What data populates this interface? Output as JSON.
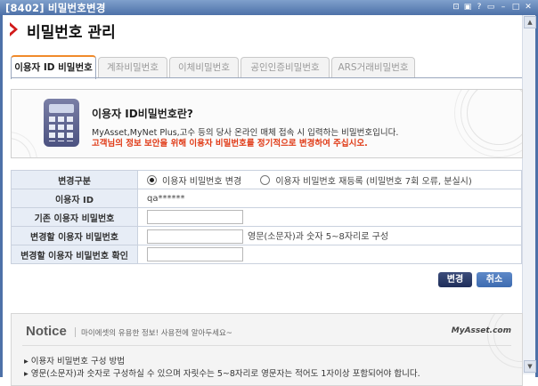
{
  "window": {
    "title": "[8402] 비밀번호변경",
    "buttons": [
      "⊡",
      "▣",
      "?",
      "▭",
      "–",
      "□",
      "✕"
    ]
  },
  "page": {
    "title": "비밀번호 관리"
  },
  "tabs": [
    {
      "label": "이용자 ID 비밀번호",
      "active": true
    },
    {
      "label": "계좌비밀번호",
      "active": false
    },
    {
      "label": "이체비밀번호",
      "active": false
    },
    {
      "label": "공인인증비밀번호",
      "active": false
    },
    {
      "label": "ARS거래비밀번호",
      "active": false
    }
  ],
  "info": {
    "heading": "이용자 ID비밀번호란?",
    "desc": "MyAsset,MyNet Plus,고수 등의 당사 온라인 매체 접속 시 입력하는 비밀번호입니다.",
    "warning": "고객님의 정보 보안을 위해 이용자 비밀번호를 정기적으로 변경하여 주십시오."
  },
  "form": {
    "change_type_label": "변경구분",
    "option_change": "이용자 비밀번호 변경",
    "option_reregister": "이용자 비밀번호 재등록 (비밀번호 7회 오류, 분실시)",
    "user_id_label": "이용자 ID",
    "user_id_value": "qa******",
    "current_pw_label": "기존 이용자 비밀번호",
    "new_pw_label": "변경할 이용자 비밀번호",
    "new_pw_hint": "영문(소문자)과 숫자 5~8자리로 구성",
    "confirm_pw_label": "변경할 이용자 비밀번호 확인"
  },
  "actions": {
    "change": "변경",
    "cancel": "취소"
  },
  "notice": {
    "title": "Notice",
    "subtitle": "마이에셋의 유용한 정보! 사용전에 알아두세요~",
    "brand": "MyAsset.com",
    "item1": "▸ 이용자 비밀번호 구성 방법",
    "item2": "▸ 영문(소문자)과 숫자로 구성하실 수 있으며 자릿수는 5~8자리로 영문자는 적어도 1자이상 포함되어야 합니다."
  }
}
